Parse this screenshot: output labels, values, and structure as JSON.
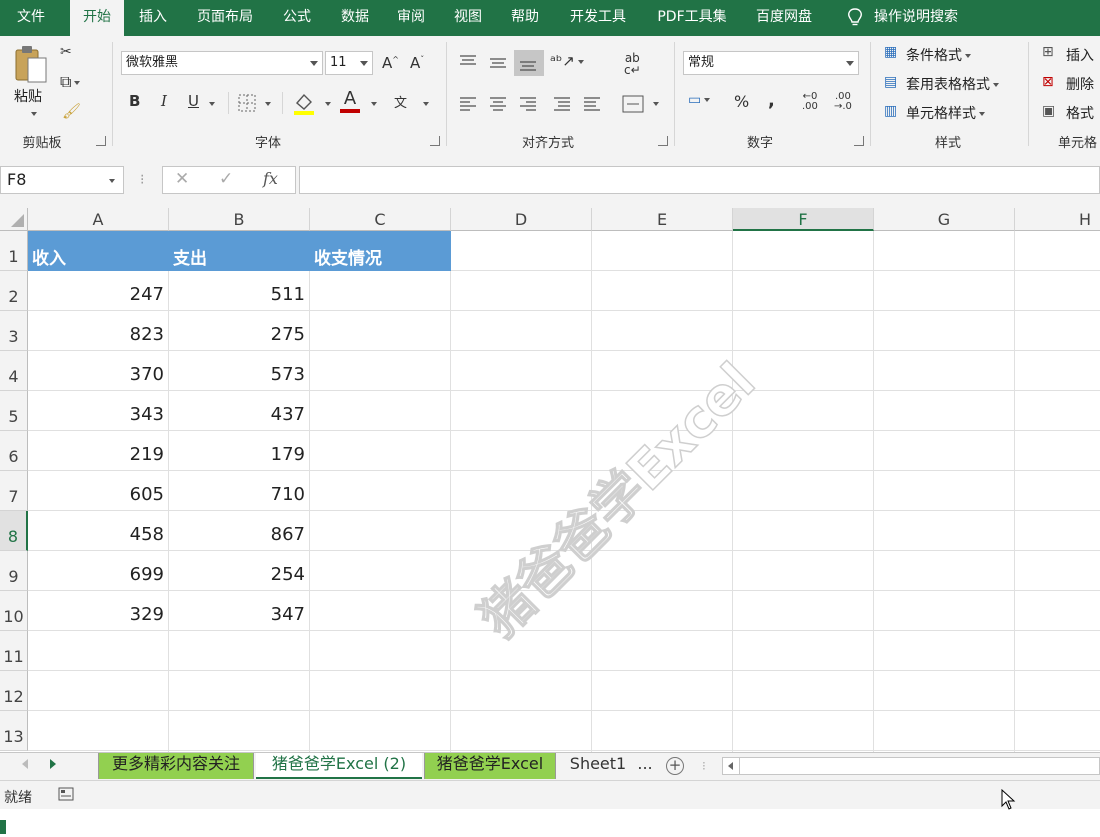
{
  "menu": {
    "tabs": [
      "文件",
      "开始",
      "插入",
      "页面布局",
      "公式",
      "数据",
      "审阅",
      "视图",
      "帮助",
      "开发工具",
      "PDF工具集",
      "百度网盘"
    ],
    "active_tab": "开始",
    "search": "操作说明搜索"
  },
  "ribbon": {
    "clipboard": {
      "paste_label": "粘贴",
      "group_label": "剪贴板"
    },
    "font": {
      "font_name": "微软雅黑",
      "font_size": "11",
      "bold": "B",
      "italic": "I",
      "underline": "U",
      "grow": "A",
      "shrink": "A",
      "font_color_glyph": "A",
      "phonetic": "文",
      "group_label": "字体"
    },
    "alignment": {
      "group_label": "对齐方式"
    },
    "number": {
      "format": "常规",
      "percent": "%",
      "comma": ",",
      "group_label": "数字"
    },
    "styles": {
      "conditional": "条件格式",
      "table": "套用表格格式",
      "cell": "单元格样式",
      "group_label": "样式"
    },
    "cells": {
      "insert": "插入",
      "delete": "删除",
      "format": "格式",
      "group_label": "单元格"
    }
  },
  "formula_bar": {
    "name_box": "F8",
    "fx": "fx",
    "cancel": "✕",
    "confirm": "✓",
    "value": ""
  },
  "columns": [
    "A",
    "B",
    "C",
    "D",
    "E",
    "F",
    "G",
    "H"
  ],
  "rows": [
    "1",
    "2",
    "3",
    "4",
    "5",
    "6",
    "7",
    "8",
    "9",
    "10",
    "11",
    "12",
    "13"
  ],
  "table": {
    "headers": [
      "收入",
      "支出",
      "收支情况"
    ],
    "income": [
      "247",
      "823",
      "370",
      "343",
      "219",
      "605",
      "458",
      "699",
      "329"
    ],
    "expense": [
      "511",
      "275",
      "573",
      "437",
      "179",
      "710",
      "867",
      "254",
      "347"
    ]
  },
  "watermark": "猪爸爸学Excel",
  "sheets": [
    "更多精彩内容关注",
    "猪爸爸学Excel (2)",
    "猪爸爸学Excel",
    "Sheet1",
    "..."
  ],
  "status": {
    "ready": "就绪"
  },
  "colors": {
    "excel_green": "#217346",
    "header_blue": "#5b9bd5",
    "tab_green": "#92d050"
  }
}
